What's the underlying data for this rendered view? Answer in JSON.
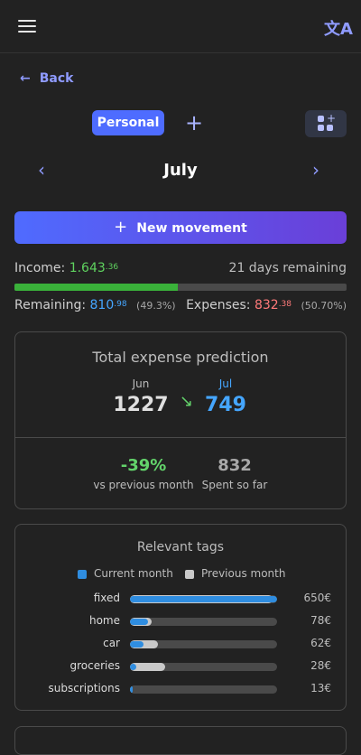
{
  "header": {
    "menu_icon": "hamburger-menu-icon",
    "translate_icon": "translate-icon",
    "translate_glyph": "文A"
  },
  "nav": {
    "back_label": "Back"
  },
  "tabs": {
    "active_label": "Personal"
  },
  "month": {
    "title": "July"
  },
  "actions": {
    "new_movement_label": "New movement"
  },
  "budget": {
    "income_label": "Income:",
    "income_int": "1.643",
    "income_dec": ".36",
    "days_remaining": "21 days remaining",
    "progress_fraction": 0.493,
    "remaining_label": "Remaining:",
    "remaining_int": "810",
    "remaining_dec": ".98",
    "remaining_pct": "(49.3%)",
    "expenses_label": "Expenses:",
    "expenses_int": "832",
    "expenses_dec": ".38",
    "expenses_pct": "(50.70%)"
  },
  "prediction": {
    "title": "Total expense prediction",
    "prev_month": "Jun",
    "prev_value": "1227",
    "cur_month": "Jul",
    "cur_value": "749",
    "change": "-39%",
    "change_label": "vs previous month",
    "spent": "832",
    "spent_label": "Spent so far"
  },
  "tags": {
    "title": "Relevant tags",
    "legend_current": "Current month",
    "legend_previous": "Previous month",
    "colors": {
      "current": "#2f8de0",
      "previous": "#c9c9c9"
    },
    "rows": [
      {
        "name": "fixed",
        "amount": "650€",
        "current": 1.0,
        "previous": 0.97
      },
      {
        "name": "home",
        "amount": "78€",
        "current": 0.12,
        "previous": 0.15
      },
      {
        "name": "car",
        "amount": "62€",
        "current": 0.09,
        "previous": 0.19
      },
      {
        "name": "groceries",
        "amount": "28€",
        "current": 0.04,
        "previous": 0.24
      },
      {
        "name": "subscriptions",
        "amount": "13€",
        "current": 0.02,
        "previous": 0.01
      }
    ]
  }
}
